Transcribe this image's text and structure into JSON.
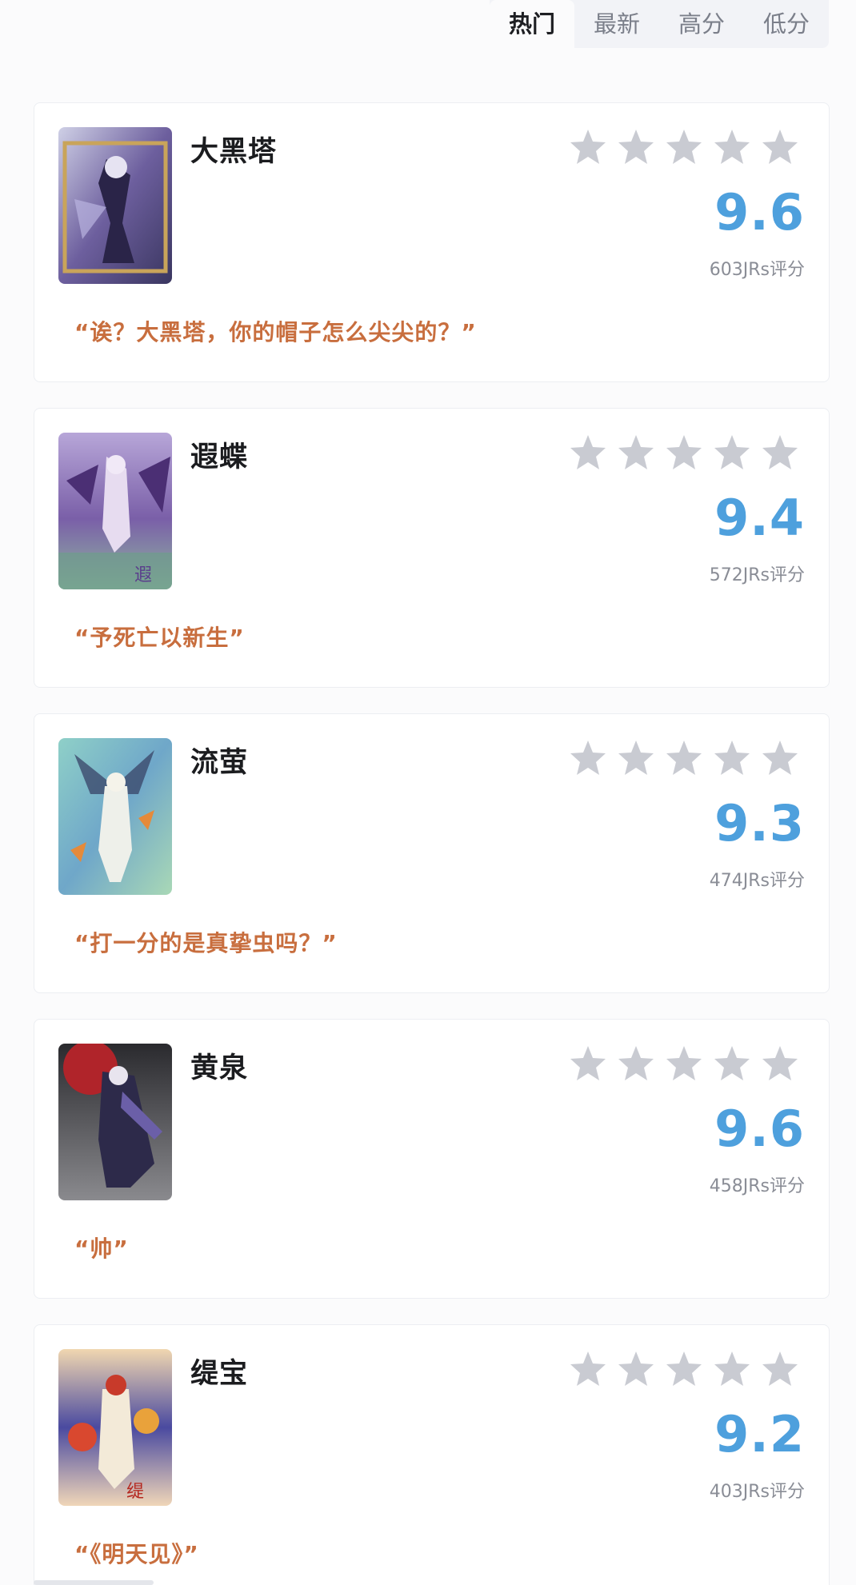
{
  "tabs": [
    {
      "label": "热门",
      "active": true
    },
    {
      "label": "最新",
      "active": false
    },
    {
      "label": "高分",
      "active": false
    },
    {
      "label": "低分",
      "active": false
    }
  ],
  "colors": {
    "score": "#4ea0dd",
    "quote": "#c86e3e",
    "star_empty": "#c9cbd2"
  },
  "cards": [
    {
      "name": "大黑塔",
      "rating_stars": 0,
      "score": "9.6",
      "count": "603JRs评分",
      "quote": "“诶？大黑塔，你的帽子怎么尖尖的？”",
      "image_icon": "character-portrait-icon"
    },
    {
      "name": "遐蝶",
      "rating_stars": 0,
      "score": "9.4",
      "count": "572JRs评分",
      "quote": "“予死亡以新生”",
      "image_icon": "character-portrait-icon"
    },
    {
      "name": "流萤",
      "rating_stars": 0,
      "score": "9.3",
      "count": "474JRs评分",
      "quote": "“打一分的是真挚虫吗？”",
      "image_icon": "character-portrait-icon"
    },
    {
      "name": "黄泉",
      "rating_stars": 0,
      "score": "9.6",
      "count": "458JRs评分",
      "quote": "“帅”",
      "image_icon": "character-portrait-icon"
    },
    {
      "name": "缇宝",
      "rating_stars": 0,
      "score": "9.2",
      "count": "403JRs评分",
      "quote": "“《明天见》”",
      "image_icon": "character-portrait-icon"
    }
  ]
}
